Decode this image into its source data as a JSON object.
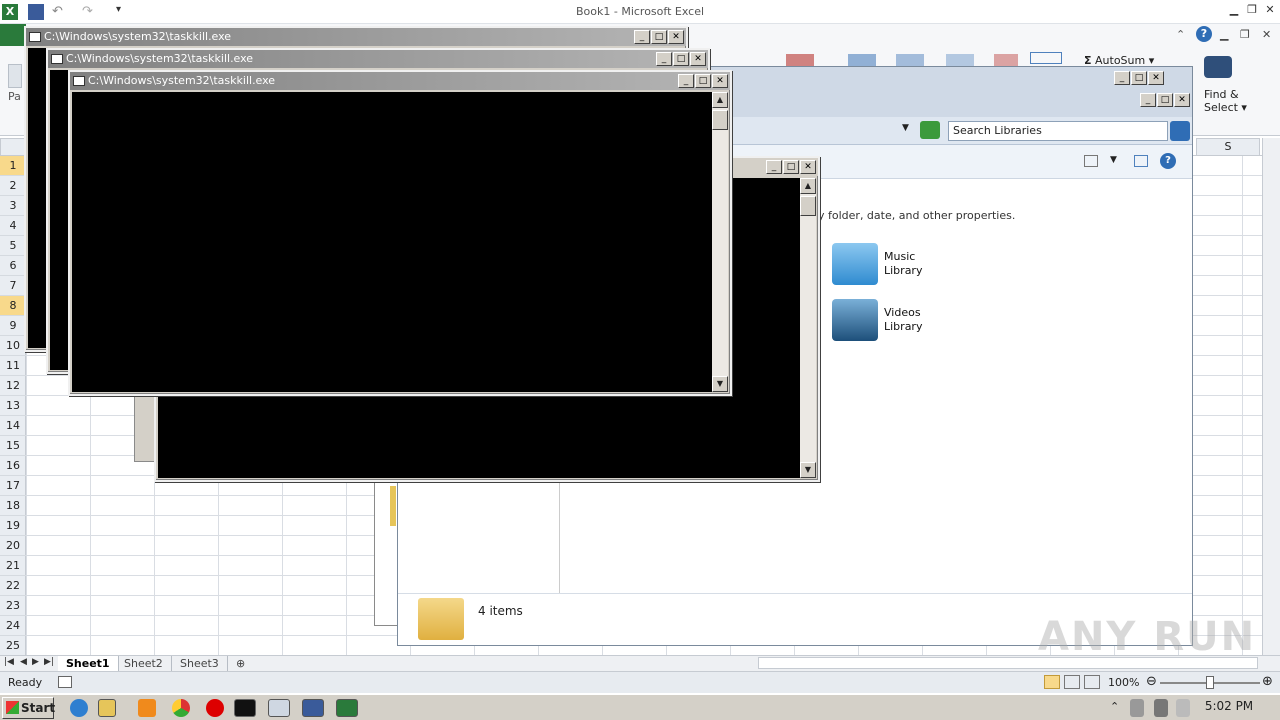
{
  "excel": {
    "title": "Book1 - Microsoft Excel",
    "ribbon": {
      "autosum_label": "AutoSum",
      "find_select_label": "Find &",
      "find_select_label2": "Select",
      "paste_label": "Pa"
    },
    "column_header": "S",
    "rows": [
      "1",
      "2",
      "3",
      "4",
      "5",
      "6",
      "7",
      "8",
      "9",
      "10",
      "11",
      "12",
      "13",
      "14",
      "15",
      "16",
      "17",
      "18",
      "19",
      "20",
      "21",
      "22",
      "23",
      "24",
      "25"
    ],
    "sheets": [
      "Sheet1",
      "Sheet2",
      "Sheet3"
    ],
    "status": "Ready",
    "zoom": "100%"
  },
  "explorer": {
    "search_placeholder": "Search Libraries",
    "description": "y folder, date, and other properties.",
    "libraries": [
      {
        "line1": "Music",
        "line2": "Library"
      },
      {
        "line1": "Videos",
        "line2": "Library"
      }
    ],
    "items_count": "4 items"
  },
  "consoles": [
    {
      "title": "C:\\Windows\\system32\\taskkill.exe"
    },
    {
      "title": "C:\\Windows\\system32\\taskkill.exe"
    },
    {
      "title": "C:\\Windows\\system32\\taskkill.exe"
    }
  ],
  "taskbar": {
    "start_label": "Start",
    "clock": "5:02 PM"
  },
  "watermark": "ANY RUN",
  "colors": {
    "excel_green": "#2a7a3b",
    "console_bg": "#000000",
    "titlebar_gray": "#808080"
  }
}
